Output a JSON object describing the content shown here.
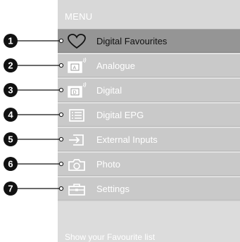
{
  "menu": {
    "title": "MENU",
    "items": [
      {
        "label": "Digital Favourites",
        "icon": "heart-icon",
        "selected": true,
        "number": "1"
      },
      {
        "label": "Analogue",
        "icon": "analogue-tv-icon",
        "selected": false,
        "number": "2"
      },
      {
        "label": "Digital",
        "icon": "digital-tv-icon",
        "selected": false,
        "number": "3"
      },
      {
        "label": "Digital EPG",
        "icon": "epg-list-icon",
        "selected": false,
        "number": "4"
      },
      {
        "label": "External Inputs",
        "icon": "input-arrow-icon",
        "selected": false,
        "number": "5"
      },
      {
        "label": "Photo",
        "icon": "camera-icon",
        "selected": false,
        "number": "6"
      },
      {
        "label": "Settings",
        "icon": "toolbox-icon",
        "selected": false,
        "number": "7"
      }
    ],
    "hint": "Show your Favourite list"
  },
  "colors": {
    "panel": "#d8d8d8",
    "item": "#c9c9c9",
    "selected_item": "#959595",
    "callout": "#111111"
  }
}
